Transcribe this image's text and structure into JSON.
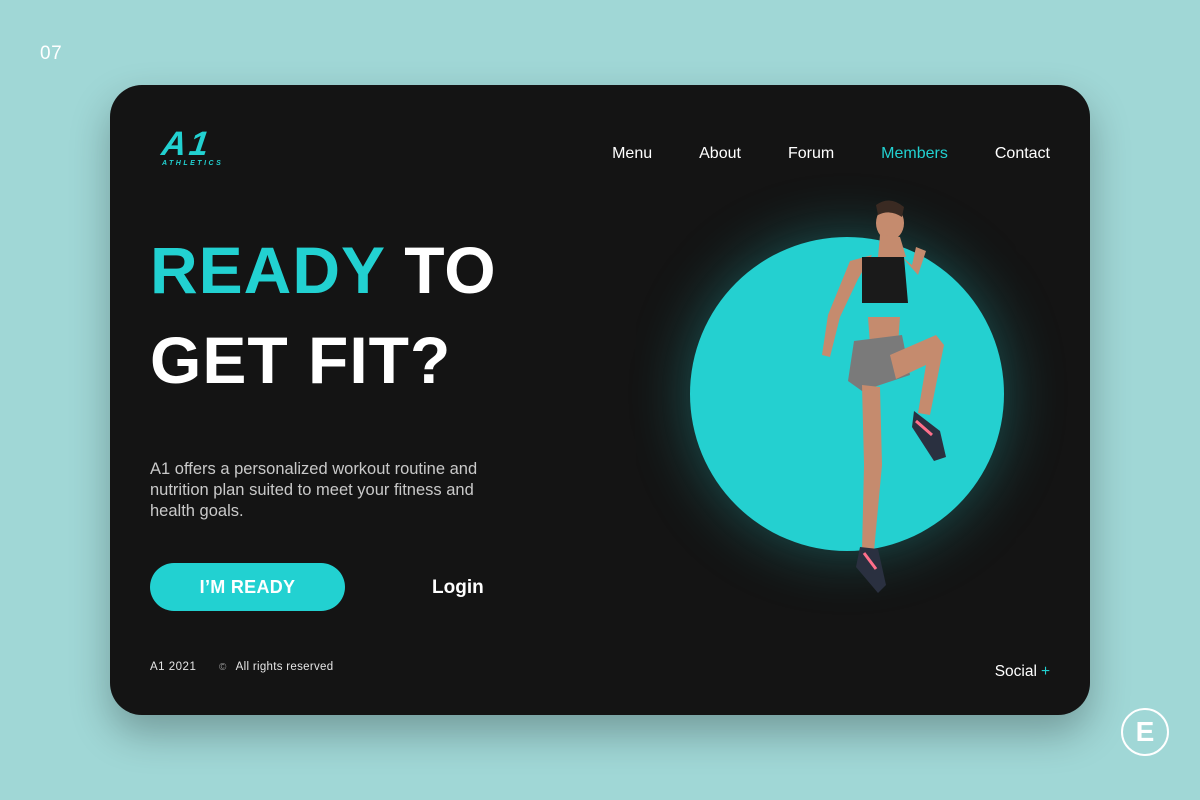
{
  "slide_number": "07",
  "brand_badge": "E",
  "logo": {
    "mark": "A1",
    "subtitle": "ATHLETICS"
  },
  "nav": {
    "items": [
      {
        "label": "Menu"
      },
      {
        "label": "About"
      },
      {
        "label": "Forum"
      },
      {
        "label": "Members"
      },
      {
        "label": "Contact"
      }
    ],
    "active": "Members"
  },
  "hero": {
    "headline_accent": "READY",
    "headline_rest": "TO",
    "headline_line2": "GET FIT?",
    "description": "A1 offers a personalized workout routine and nutrition plan suited to meet your fitness and health goals.",
    "cta_label": "I’M READY",
    "login_label": "Login"
  },
  "footer": {
    "year": "A1 2021",
    "copyright_symbol": "©",
    "rights": "All rights reserved",
    "social_label": "Social",
    "social_plus": "+"
  },
  "colors": {
    "accent": "#22d1d1",
    "card_background": "#141414",
    "page_background": "#a0d7d6"
  },
  "icons": [
    "copyright-icon",
    "plus-icon"
  ]
}
